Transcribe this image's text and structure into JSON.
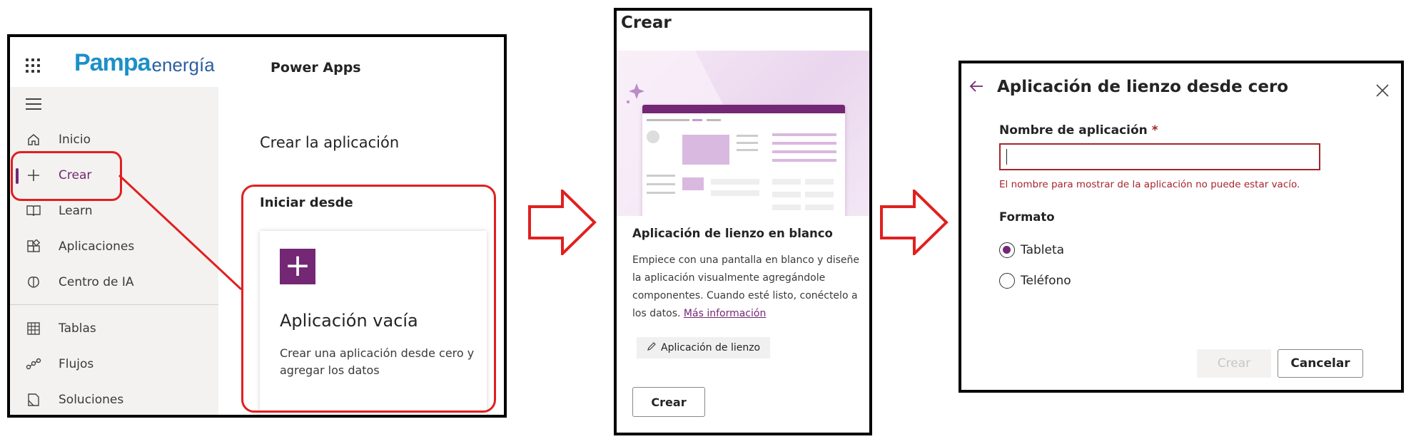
{
  "panel1": {
    "logo": {
      "brand_a": "Pampa",
      "brand_b": "energía"
    },
    "product": "Power Apps",
    "nav": {
      "items": [
        {
          "label": "Inicio",
          "icon": "home-icon"
        },
        {
          "label": "Crear",
          "icon": "plus-icon",
          "selected": true
        },
        {
          "label": "Learn",
          "icon": "book-icon"
        },
        {
          "label": "Aplicaciones",
          "icon": "apps-icon"
        },
        {
          "label": "Centro de IA",
          "icon": "brain-icon"
        },
        {
          "label": "Tablas",
          "icon": "table-icon"
        },
        {
          "label": "Flujos",
          "icon": "flow-icon"
        },
        {
          "label": "Soluciones",
          "icon": "solutions-icon"
        }
      ]
    },
    "main": {
      "title": "Crear la aplicación",
      "start_from": "Iniciar desde",
      "card": {
        "title": "Aplicación vacía",
        "description": "Crear una aplicación desde cero y agregar los datos"
      }
    }
  },
  "panel2": {
    "title": "Crear",
    "template": {
      "title": "Aplicación de lienzo en blanco",
      "description": "Empiece con una pantalla en blanco y diseñe la aplicación visualmente agregándole componentes. Cuando esté listo, conéctelo a los datos.",
      "more_link": "Más información",
      "tag": "Aplicación de lienzo"
    },
    "create_button": "Crear"
  },
  "panel3": {
    "title": "Aplicación de lienzo desde cero",
    "name_label": "Nombre de aplicación",
    "required_mark": "*",
    "name_value": "",
    "error": "El nombre para mostrar de la aplicación no puede estar vacío.",
    "format_label": "Formato",
    "formats": [
      {
        "label": "Tableta",
        "checked": true
      },
      {
        "label": "Teléfono",
        "checked": false
      }
    ],
    "create_button": "Crear",
    "cancel_button": "Cancelar"
  },
  "colors": {
    "accent": "#742774",
    "annotation_red": "#e0201f",
    "error": "#a4262c",
    "brand_blue": "#1d8fc8"
  }
}
